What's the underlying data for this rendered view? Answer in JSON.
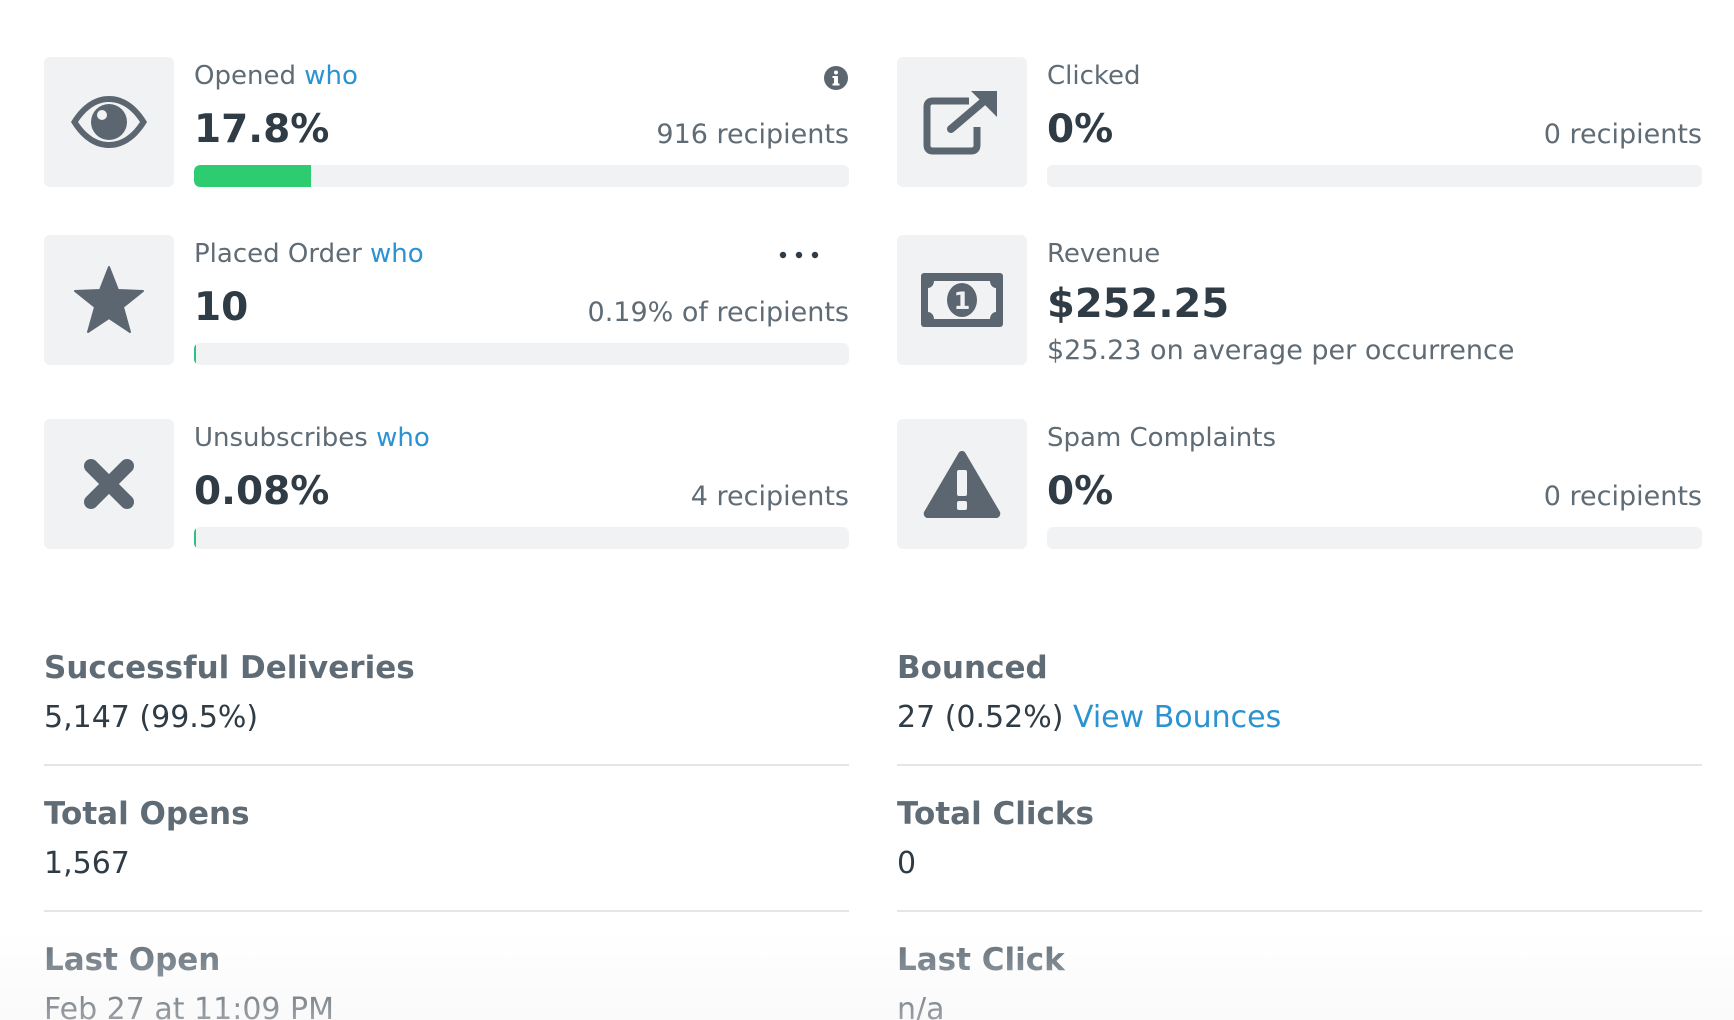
{
  "metrics": {
    "opened": {
      "label": "Opened",
      "who": "who",
      "value": "17.8%",
      "side": "916 recipients",
      "progress_percent": 17.8,
      "icon": "eye-icon"
    },
    "clicked": {
      "label": "Clicked",
      "value": "0%",
      "side": "0 recipients",
      "progress_percent": 0,
      "icon": "external-link-icon"
    },
    "placed_order": {
      "label": "Placed Order",
      "who": "who",
      "value": "10",
      "side": "0.19% of recipients",
      "progress_percent": 0.19,
      "icon": "star-icon"
    },
    "revenue": {
      "label": "Revenue",
      "value": "$252.25",
      "sub": "$25.23 on average per occurrence",
      "icon": "money-bill-icon"
    },
    "unsubscribes": {
      "label": "Unsubscribes",
      "who": "who",
      "value": "0.08%",
      "side": "4 recipients",
      "progress_percent": 0.08,
      "icon": "close-x-icon"
    },
    "spam": {
      "label": "Spam Complaints",
      "value": "0%",
      "side": "0 recipients",
      "progress_percent": 0,
      "icon": "warning-triangle-icon"
    }
  },
  "stats": {
    "successful_deliveries": {
      "title": "Successful Deliveries",
      "value": "5,147 (99.5%)"
    },
    "bounced": {
      "title": "Bounced",
      "value": "27 (0.52%)",
      "link": "View Bounces"
    },
    "total_opens": {
      "title": "Total Opens",
      "value": "1,567"
    },
    "total_clicks": {
      "title": "Total Clicks",
      "value": "0"
    },
    "last_open": {
      "title": "Last Open",
      "value": "Feb 27 at 11:09 PM"
    },
    "last_click": {
      "title": "Last Click",
      "value": "n/a"
    }
  },
  "colors": {
    "accent_link": "#2b93d1",
    "progress_fill": "#2ecc71",
    "icon_gray": "#5c6670",
    "tile_bg": "#f1f2f3"
  }
}
